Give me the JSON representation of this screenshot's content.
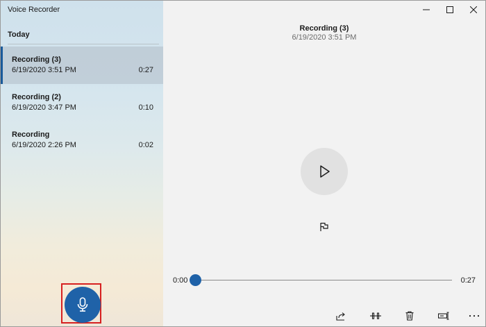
{
  "app": {
    "title": "Voice Recorder"
  },
  "sidebar": {
    "section_header": "Today",
    "recordings": [
      {
        "name": "Recording (3)",
        "date": "6/19/2020 3:51 PM",
        "duration": "0:27",
        "selected": true
      },
      {
        "name": "Recording (2)",
        "date": "6/19/2020 3:47 PM",
        "duration": "0:10",
        "selected": false
      },
      {
        "name": "Recording",
        "date": "6/19/2020 2:26 PM",
        "duration": "0:02",
        "selected": false
      }
    ],
    "record_button_icon": "microphone-icon"
  },
  "player": {
    "title": "Recording (3)",
    "date": "6/19/2020 3:51 PM",
    "current_time": "0:00",
    "total_time": "0:27",
    "progress": 0.0,
    "play_icon": "play-icon",
    "marker_icon": "flag-icon"
  },
  "toolbar": {
    "icons": [
      "share-icon",
      "trim-icon",
      "delete-icon",
      "rename-icon",
      "more-icon"
    ]
  },
  "window_controls": [
    "minimize-icon",
    "maximize-icon",
    "close-icon"
  ],
  "colors": {
    "accent": "#1f62a8",
    "highlight_box": "#d62020",
    "selected_row": "#aab4be"
  }
}
